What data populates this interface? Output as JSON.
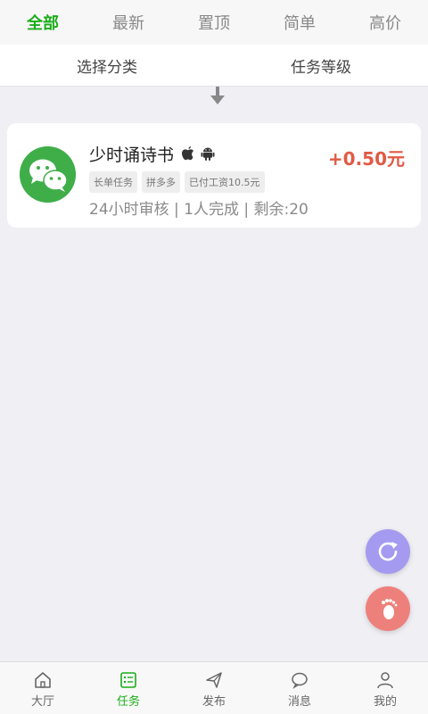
{
  "top_tabs": [
    {
      "label": "全部",
      "active": true
    },
    {
      "label": "最新",
      "active": false
    },
    {
      "label": "置顶",
      "active": false
    },
    {
      "label": "简单",
      "active": false
    },
    {
      "label": "高价",
      "active": false
    }
  ],
  "filters": {
    "category": "选择分类",
    "level": "任务等级"
  },
  "task": {
    "logo_icon": "wechat-icon",
    "title": "少时诵诗书",
    "platforms": [
      "apple-icon",
      "android-icon"
    ],
    "price": "+0.50元",
    "tags": [
      "长单任务",
      "拼多多",
      "已付工资10.5元"
    ],
    "meta": "24小时审核 |  1人完成 |  剩余:20"
  },
  "fabs": {
    "refresh_icon": "refresh-icon",
    "foot_icon": "footprint-icon"
  },
  "bottom_nav": [
    {
      "label": "大厅",
      "icon": "home-icon",
      "active": false
    },
    {
      "label": "任务",
      "icon": "task-list-icon",
      "active": true
    },
    {
      "label": "发布",
      "icon": "send-icon",
      "active": false
    },
    {
      "label": "消息",
      "icon": "message-icon",
      "active": false
    },
    {
      "label": "我的",
      "icon": "user-icon",
      "active": false
    }
  ],
  "colors": {
    "accent": "#1aad19",
    "price": "#e05a44",
    "wechat": "#3fae49",
    "fab_refresh": "#a49af0",
    "fab_foot": "#ee807b"
  }
}
